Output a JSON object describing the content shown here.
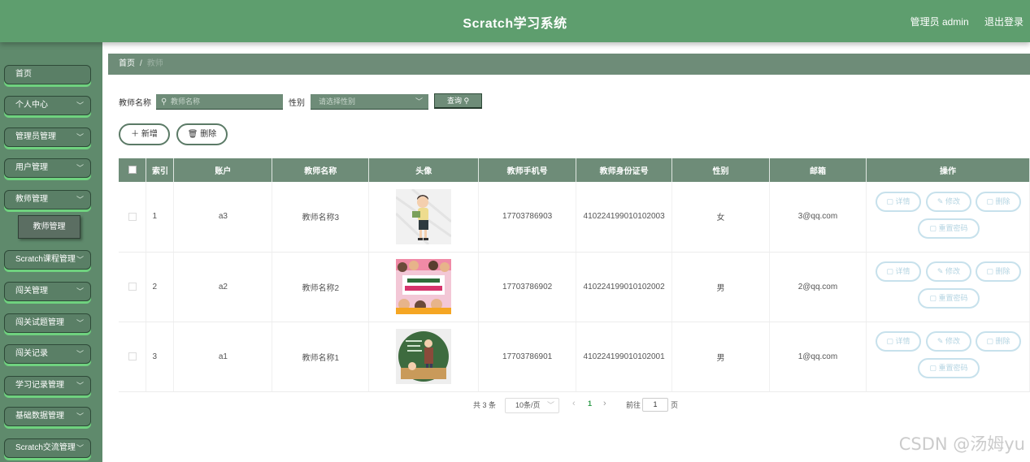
{
  "header": {
    "title": "Scratch学习系统",
    "user": "管理员 admin",
    "logout": "退出登录",
    "color": "#5e9e6e"
  },
  "sidebar": {
    "items": [
      {
        "label": "首页",
        "has_arrow": false
      },
      {
        "label": "个人中心",
        "has_arrow": true
      },
      {
        "label": "管理员管理",
        "has_arrow": true
      },
      {
        "label": "用户管理",
        "has_arrow": true
      },
      {
        "label": "教师管理",
        "has_arrow": true
      },
      {
        "label": "Scratch课程管理",
        "has_arrow": true
      },
      {
        "label": "闯关管理",
        "has_arrow": true
      },
      {
        "label": "闯关试题管理",
        "has_arrow": true
      },
      {
        "label": "闯关记录",
        "has_arrow": true
      },
      {
        "label": "学习记录管理",
        "has_arrow": true
      },
      {
        "label": "基础数据管理",
        "has_arrow": true
      },
      {
        "label": "Scratch交流管理",
        "has_arrow": true
      }
    ],
    "active_sub": "教师管理"
  },
  "breadcrumb": {
    "home": "首页",
    "sep": "/",
    "current": "教师"
  },
  "search": {
    "name_label": "教师名称",
    "name_placeholder": "教师名称",
    "gender_label": "性别",
    "gender_placeholder": "请选择性别",
    "query_label": "查询"
  },
  "actions": {
    "add": "新增",
    "delete": "删除"
  },
  "table": {
    "columns": [
      "索引",
      "账户",
      "教师名称",
      "头像",
      "教师手机号",
      "教师身份证号",
      "性别",
      "邮箱",
      "操作"
    ],
    "rows": [
      {
        "index": "1",
        "account": "a3",
        "name": "教师名称3",
        "phone": "17703786903",
        "id_card": "410224199010102003",
        "gender": "女",
        "email": "3@qq.com"
      },
      {
        "index": "2",
        "account": "a2",
        "name": "教师名称2",
        "phone": "17703786902",
        "id_card": "410224199010102002",
        "gender": "男",
        "email": "2@qq.com"
      },
      {
        "index": "3",
        "account": "a1",
        "name": "教师名称1",
        "phone": "17703786901",
        "id_card": "410224199010102001",
        "gender": "男",
        "email": "1@qq.com"
      }
    ],
    "row_actions": {
      "detail": "详情",
      "edit": "修改",
      "delete": "删除",
      "reset": "重置密码"
    }
  },
  "pagination": {
    "total": "共 3 条",
    "page_size": "10条/页",
    "current_page": "1",
    "goto_label": "前往",
    "goto_value": "1",
    "page_suffix": "页"
  },
  "watermark": "CSDN @汤姆yu"
}
